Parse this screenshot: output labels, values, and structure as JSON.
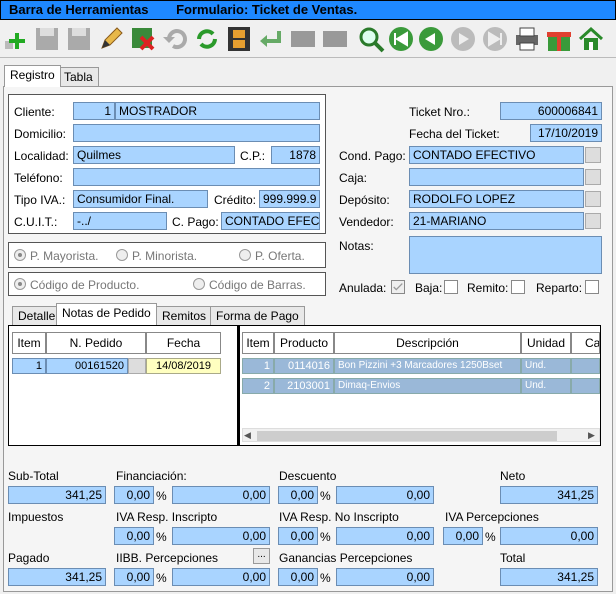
{
  "title": {
    "left": "Barra de Herramientas",
    "right": "Formulario: Ticket de Ventas."
  },
  "toolbar": {
    "icons": [
      "add-icon",
      "save-icon",
      "save-as-icon",
      "edit-icon",
      "delete-icon",
      "undo-icon",
      "refresh-icon",
      "film-icon",
      "return-icon",
      "disabled-1-icon",
      "disabled-2-icon",
      "search-icon",
      "first-icon",
      "previous-icon",
      "next-icon",
      "last-icon",
      "print-icon",
      "gift-icon",
      "home-icon"
    ]
  },
  "main_tabs": [
    "Registro",
    "Tabla"
  ],
  "cliente": {
    "label": "Cliente:",
    "code": "1",
    "name": "MOSTRADOR"
  },
  "domicilio": {
    "label": "Domicilio:",
    "value": ""
  },
  "localidad": {
    "label": "Localidad:",
    "value": "Quilmes",
    "cp_label": "C.P.:",
    "cp": "1878"
  },
  "telefono": {
    "label": "Teléfono:",
    "value": ""
  },
  "tipo_iva": {
    "label": "Tipo IVA.:",
    "value": "Consumidor Final.",
    "credito_label": "Crédito:",
    "credito": "999.999.9"
  },
  "cuit": {
    "label": "C.U.I.T.:",
    "value": "-../",
    "cpago_label": "C. Pago:",
    "cpago": "CONTADO EFEC"
  },
  "precios": {
    "mayorista": "P. Mayorista.",
    "minorista": "P. Minorista.",
    "oferta": "P. Oferta."
  },
  "codigos": {
    "producto": "Código de Producto.",
    "barras": "Código de Barras."
  },
  "ticket": {
    "label": "Ticket Nro.:",
    "value": "600006841",
    "fecha_label": "Fecha del Ticket:",
    "fecha": "17/10/2019"
  },
  "cond_pago": {
    "label": "Cond. Pago:",
    "value": "CONTADO EFECTIVO"
  },
  "caja": {
    "label": "Caja:",
    "value": ""
  },
  "deposito": {
    "label": "Depósito:",
    "value": "RODOLFO LOPEZ"
  },
  "vendedor": {
    "label": "Vendedor:",
    "value": "21-MARIANO"
  },
  "notas": {
    "label": "Notas:",
    "value": ""
  },
  "flags": {
    "anulada": "Anulada:",
    "baja": "Baja:",
    "remito": "Remito:",
    "reparto": "Reparto:"
  },
  "sub_tabs": [
    "Detalle",
    "Notas de Pedido",
    "Remitos",
    "Forma de Pago"
  ],
  "pedidos": {
    "headers": [
      "Item",
      "N. Pedido",
      "Fecha"
    ],
    "rows": [
      [
        "1",
        "00161520",
        "14/08/2019"
      ]
    ]
  },
  "productos": {
    "headers": [
      "Item",
      "Producto",
      "Descripción",
      "Unidad",
      "Ca"
    ],
    "rows": [
      [
        "1",
        "0114016",
        "Bon Pizzini +3 Marcadores 1250Bset",
        "Und."
      ],
      [
        "2",
        "2103001",
        "Dimaq-Envios",
        "Und."
      ]
    ]
  },
  "totales": {
    "subtotal_label": "Sub-Total",
    "subtotal": "341,25",
    "financiacion_label": "Financiación:",
    "financiacion_pct": "0,00",
    "financiacion": "0,00",
    "descuento_label": "Descuento",
    "descuento_pct": "0,00",
    "descuento": "0,00",
    "neto_label": "Neto",
    "neto": "341,25",
    "impuestos_label": "Impuestos",
    "iva_ri_label": "IVA Resp. Inscripto",
    "iva_ri_pct": "0,00",
    "iva_ri": "0,00",
    "iva_rni_label": "IVA Resp. No Inscripto",
    "iva_rni_pct": "0,00",
    "iva_rni": "0,00",
    "iva_perc_label": "IVA Percepciones",
    "iva_perc_pct": "0,00",
    "iva_perc": "0,00",
    "pagado_label": "Pagado",
    "pagado": "341,25",
    "iibb_label": "IIBB. Percepciones",
    "iibb_pct": "0,00",
    "iibb": "0,00",
    "ganancias_label": "Ganancias Percepciones",
    "ganancias_pct": "0,00",
    "ganancias": "0,00",
    "total_label": "Total",
    "total": "341,25",
    "pct": "%",
    "dots": "..."
  }
}
